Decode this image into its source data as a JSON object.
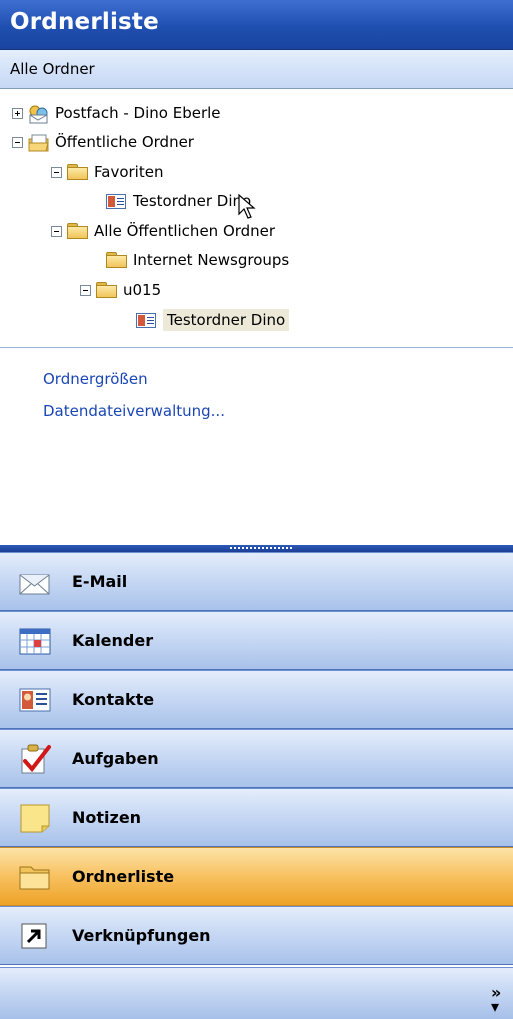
{
  "header": {
    "title": "Ordnerliste"
  },
  "subheader": {
    "label": "Alle Ordner"
  },
  "tree": {
    "mailbox": "Postfach - Dino Eberle",
    "public_folders": "Öffentliche Ordner",
    "favorites": "Favoriten",
    "favorites_item": "Testordner Dino",
    "all_public": "Alle Öffentlichen Ordner",
    "newsgroups": "Internet Newsgroups",
    "u015": "u015",
    "u015_item": "Testordner Dino"
  },
  "links": {
    "folder_sizes": "Ordnergrößen",
    "data_files": "Datendateiverwaltung..."
  },
  "nav": {
    "mail": "E-Mail",
    "calendar": "Kalender",
    "contacts": "Kontakte",
    "tasks": "Aufgaben",
    "notes": "Notizen",
    "folderlist": "Ordnerliste",
    "shortcuts": "Verknüpfungen"
  },
  "icons": {
    "expand": "plus-box-icon",
    "collapse": "minus-box-icon",
    "folder": "folder-icon",
    "contact_folder": "contact-card-icon",
    "more": "chevron-double-down-icon"
  },
  "colors": {
    "header": "#1f4fb0",
    "link": "#1a46b5",
    "active_nav": "#f8c466"
  }
}
